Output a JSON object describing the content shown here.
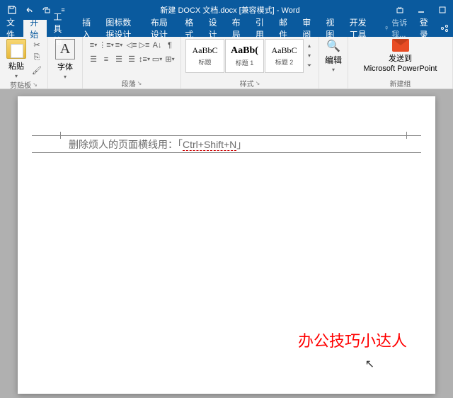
{
  "titlebar": {
    "title": "新建 DOCX 文档.docx [兼容模式] - Word"
  },
  "tabs": {
    "file": "文件",
    "home": "开始",
    "toolbox": "工具箱",
    "insert": "插入",
    "icondata": "图标数据设计",
    "layoutdesign": "布局设计",
    "format": "格式",
    "design": "设计",
    "layout": "布局",
    "references": "引用",
    "mail": "邮件",
    "review": "审阅",
    "view": "视图",
    "devtools": "开发工具",
    "tellme": "告诉我...",
    "login": "登录"
  },
  "ribbon": {
    "paste": {
      "label": "粘贴"
    },
    "clipboard_group": "剪贴板",
    "font": {
      "label": "字体"
    },
    "paragraph_group": "段落",
    "styles": [
      {
        "preview": "AaBbC",
        "name": "标题"
      },
      {
        "preview": "AaBb(",
        "name": "标题 1"
      },
      {
        "preview": "AaBbC",
        "name": "标题 2"
      }
    ],
    "styles_group": "样式",
    "edit_label": "编辑",
    "send_label": "发送到",
    "send_target": "Microsoft PowerPoint",
    "newgroup": "新建组"
  },
  "document": {
    "text_prefix": "删除烦人的页面横线用：「",
    "shortcut": "Ctrl+Shift+N",
    "text_suffix": "」",
    "watermark": "办公技巧小达人"
  }
}
